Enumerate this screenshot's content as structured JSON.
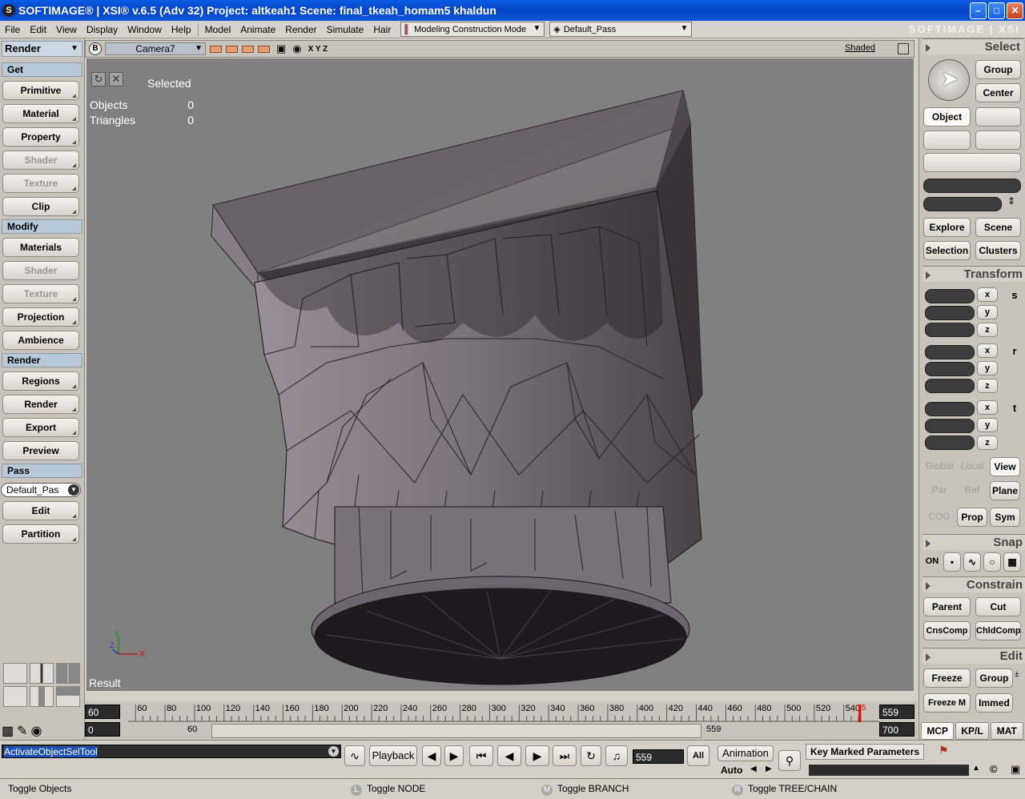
{
  "window": {
    "title": "SOFTIMAGE® | XSI® v.6.5 (Adv 32) Project: altkeah1     Scene: final_tkeah_homam5 khaldun",
    "brand": "SOFTIMAGE | XSI"
  },
  "menu": {
    "items": [
      "File",
      "Edit",
      "View",
      "Display",
      "Window",
      "Help"
    ],
    "modules": [
      "Model",
      "Animate",
      "Render",
      "Simulate",
      "Hair"
    ],
    "mode_combo": "Modeling Construction Mode",
    "pass_combo": "Default_Pass"
  },
  "left": {
    "module": "Render",
    "sections": {
      "get": "Get",
      "modify": "Modify",
      "render": "Render",
      "pass": "Pass"
    },
    "get_buttons": [
      "Primitive",
      "Material",
      "Property",
      "Shader",
      "Texture",
      "Clip"
    ],
    "modify_buttons": [
      "Materials",
      "Shader",
      "Texture",
      "Projection",
      "Ambience"
    ],
    "render_buttons": [
      "Regions",
      "Render",
      "Export",
      "Preview"
    ],
    "pass_combo": "Default_Pas",
    "pass_buttons": [
      "Edit",
      "Partition"
    ]
  },
  "viewport": {
    "b_label": "B",
    "camera": "Camera7",
    "axes_text": "X Y Z",
    "shading": "Shaded",
    "selected_label": "Selected",
    "objects_label": "Objects",
    "objects_value": "0",
    "triangles_label": "Triangles",
    "triangles_value": "0",
    "result_label": "Result",
    "axis_y": "Y",
    "axis_x": "X",
    "axis_z": "Z"
  },
  "right": {
    "select": {
      "title": "Select",
      "group": "Group",
      "center": "Center",
      "object": "Object",
      "explore": "Explore",
      "scene": "Scene",
      "selection": "Selection",
      "clusters": "Clusters"
    },
    "transform": {
      "title": "Transform",
      "x": "x",
      "y": "y",
      "z": "z",
      "s": "s",
      "r": "r",
      "t": "t",
      "global": "Global",
      "local": "Local",
      "view": "View",
      "par": "Par",
      "ref": "Ref",
      "plane": "Plane",
      "cog": "COG",
      "prop": "Prop",
      "sym": "Sym"
    },
    "snap": {
      "title": "Snap",
      "on": "ON"
    },
    "constrain": {
      "title": "Constrain",
      "parent": "Parent",
      "cut": "Cut",
      "cnscomp": "CnsComp",
      "chldcomp": "ChldComp"
    },
    "edit": {
      "title": "Edit",
      "freeze": "Freeze",
      "group": "Group",
      "freeze_m": "Freeze M",
      "immed": "Immed"
    },
    "tabs": [
      "MCP",
      "KP/L",
      "MAT"
    ]
  },
  "timeline": {
    "start": "60",
    "end": "559",
    "range_start": "0",
    "range_in": "60",
    "range_out": "559",
    "range_end": "700",
    "ticks": [
      "60",
      "80",
      "100",
      "120",
      "140",
      "160",
      "180",
      "200",
      "220",
      "240",
      "260",
      "280",
      "300",
      "320",
      "340",
      "360",
      "380",
      "400",
      "420",
      "440",
      "460",
      "480",
      "500",
      "520",
      "540"
    ],
    "current_marker": "5",
    "current_frame": 559,
    "tick_first": 60,
    "tick_last": 540
  },
  "playback": {
    "command": "ActivateObjectSelTool",
    "playback_label": "Playback",
    "frame": "559",
    "all": "All",
    "animation_label": "Animation",
    "auto": "Auto",
    "key_marked": "Key Marked Parameters"
  },
  "status": {
    "left": "Toggle Objects",
    "l_key": "L",
    "l_text": "Toggle NODE",
    "m_key": "M",
    "m_text": "Toggle BRANCH",
    "r_key": "R",
    "r_text": "Toggle TREE/CHAIN"
  }
}
